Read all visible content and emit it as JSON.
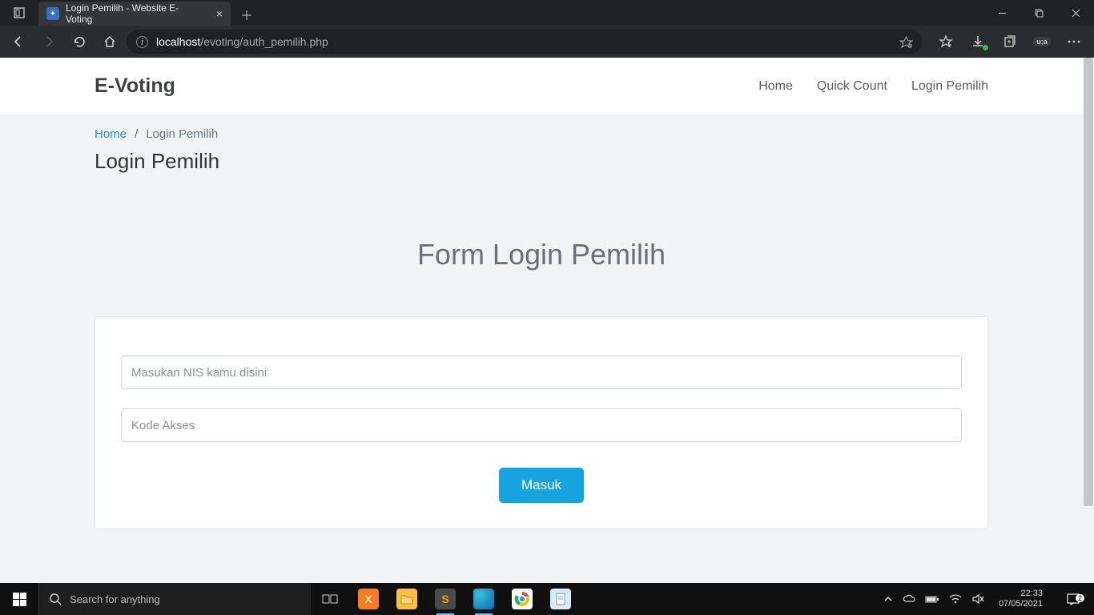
{
  "browser": {
    "tab_title": "Login Pemilih - Website E-Voting",
    "url_host": "localhost",
    "url_path": "/evoting/auth_pemilih.php"
  },
  "header": {
    "brand": "E-Voting",
    "nav": {
      "home": "Home",
      "quick": "Quick Count",
      "login": "Login Pemilih"
    }
  },
  "breadcrumb": {
    "home": "Home",
    "sep": "/",
    "current": "Login Pemilih"
  },
  "page_title": "Login Pemilih",
  "form": {
    "title": "Form Login Pemilih",
    "nis_placeholder": "Masukan NIS kamu disini",
    "kode_placeholder": "Kode Akses",
    "submit": "Masuk"
  },
  "taskbar": {
    "search_placeholder": "Search for anything",
    "time": "22:33",
    "date": "07/05/2021",
    "noti_count": "2"
  }
}
